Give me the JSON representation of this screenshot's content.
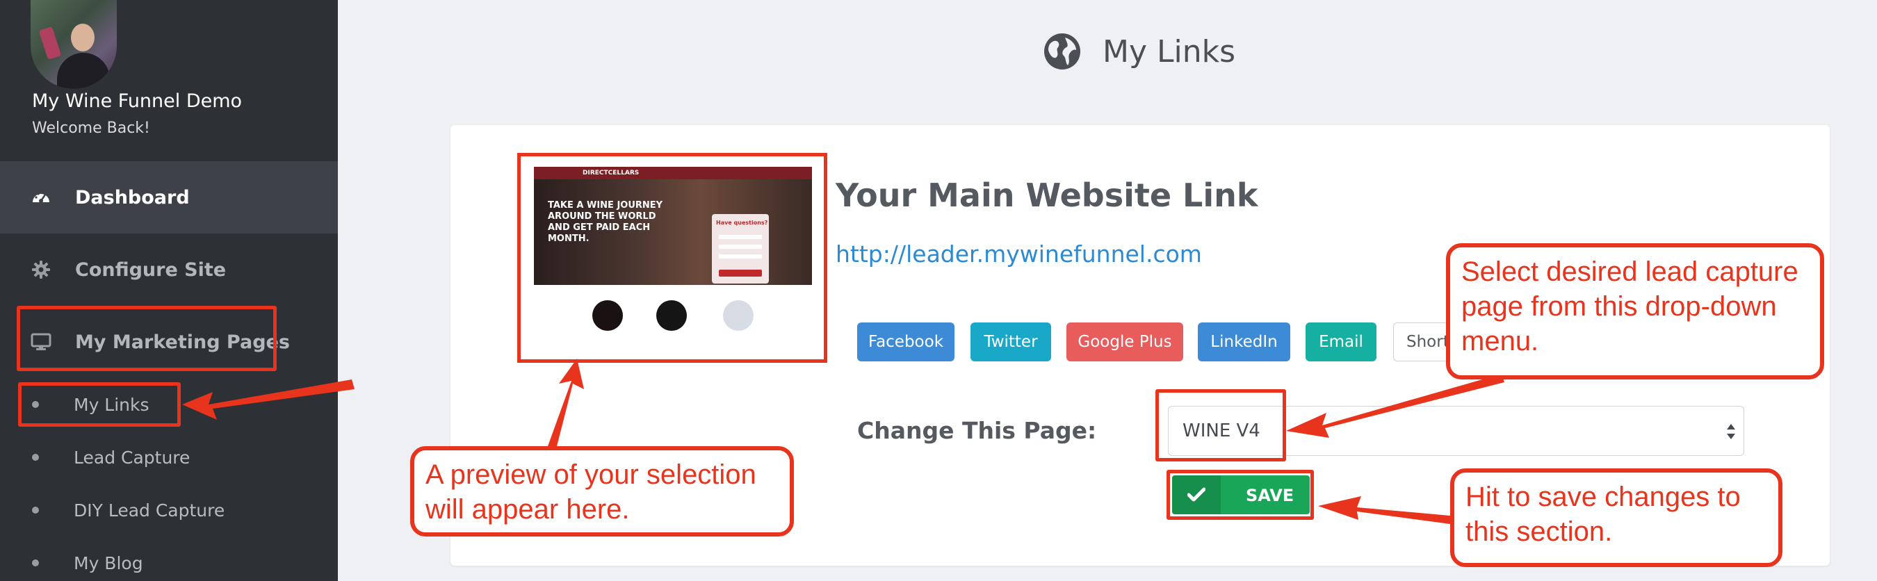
{
  "user": {
    "name": "My Wine Funnel Demo",
    "welcome": "Welcome Back!"
  },
  "sidebar": {
    "nav": [
      {
        "label": "Dashboard",
        "icon": "dashboard-gauge-icon"
      },
      {
        "label": "Configure Site",
        "icon": "gear-icon"
      },
      {
        "label": "My Marketing Pages",
        "icon": "monitor-icon"
      }
    ],
    "subnav": [
      {
        "label": "My Links"
      },
      {
        "label": "Lead Capture"
      },
      {
        "label": "DIY Lead Capture"
      },
      {
        "label": "My Blog"
      }
    ]
  },
  "main": {
    "page_title": "My Links",
    "page_icon": "globe-icon",
    "card": {
      "heading": "Your Main Website Link",
      "url": "http://leader.mywinefunnel.com",
      "preview": {
        "logo": "DIRECTCELLARS",
        "headline": "TAKE A WINE JOURNEY AROUND THE WORLD AND GET PAID EACH MONTH.",
        "form_title": "Have questions?"
      },
      "share_buttons": [
        {
          "label": "Facebook"
        },
        {
          "label": "Twitter"
        },
        {
          "label": "Google Plus"
        },
        {
          "label": "LinkedIn"
        },
        {
          "label": "Email"
        },
        {
          "label": "Short"
        }
      ],
      "change_label": "Change This Page:",
      "select_value": "WINE V4",
      "save_label": "SAVE"
    }
  },
  "annotations": {
    "preview_note": "A preview of your selection will appear here.",
    "select_note": "Select desired lead capture page from this drop-down menu.",
    "save_note": "Hit to save changes to this section."
  },
  "colors": {
    "sidebar_bg": "#2d3035",
    "active_nav_bg": "#3e4248",
    "annotation_red": "#e8341c",
    "save_green": "#1aa659",
    "link_blue": "#2a8ad4"
  }
}
